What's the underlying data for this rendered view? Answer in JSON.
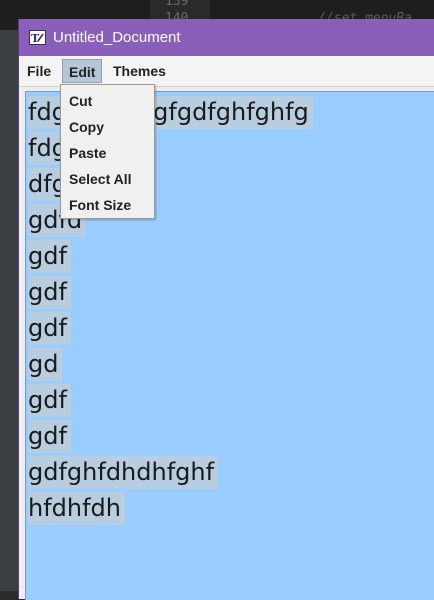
{
  "background_editor": {
    "line_numbers": [
      "139",
      "140"
    ],
    "code_snippet": "//set menuBa"
  },
  "window": {
    "title": "Untitled_Document",
    "icon": "text-editor-app-icon"
  },
  "menubar": {
    "items": [
      {
        "label": "File"
      },
      {
        "label": "Edit",
        "active": true
      },
      {
        "label": "Themes"
      }
    ]
  },
  "edit_menu": {
    "items": [
      {
        "label": "Cut"
      },
      {
        "label": "Copy"
      },
      {
        "label": "Paste"
      },
      {
        "label": "Select All"
      },
      {
        "label": "Font Size"
      }
    ]
  },
  "document": {
    "lines": [
      "fdgfghfghfgfgdfghfghfg",
      "fdgfd",
      "dfgfd",
      "gdfd",
      "gdf",
      "gdf",
      "gdf",
      "gd",
      "gdf",
      "gdf",
      "gdfghfdhdhfghf",
      "hfdhfdh"
    ]
  },
  "colors": {
    "titlebar": "#8a5fba",
    "text_area_background": "#99ccff",
    "selection_highlight": "#b8cde0"
  }
}
